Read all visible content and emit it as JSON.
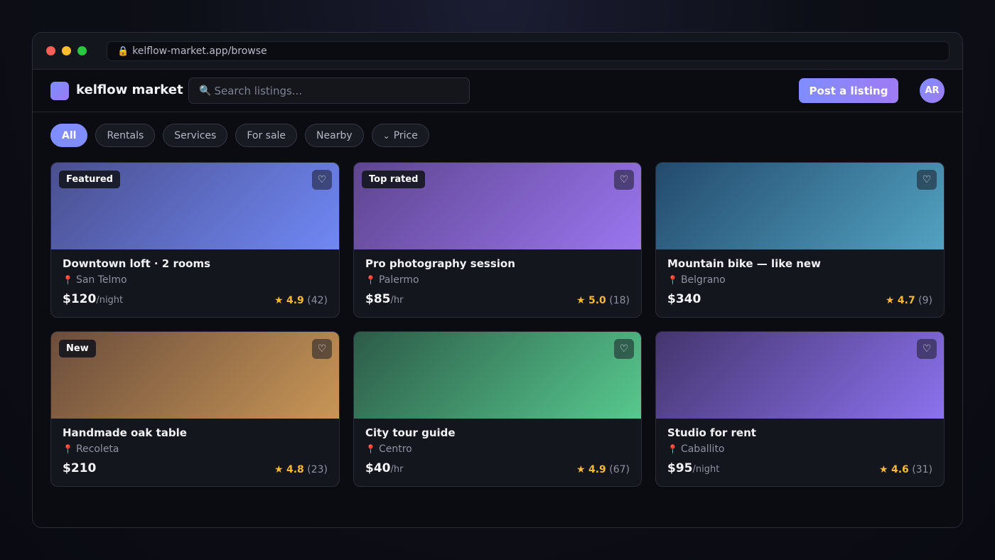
{
  "browser": {
    "url": "kelflow-market.app/browse",
    "lock_icon": "🔒"
  },
  "header": {
    "brand": "kelflow market",
    "search_placeholder": "Search listings...",
    "search_icon": "🔍",
    "post_button": "Post a listing",
    "avatar_initials": "AR"
  },
  "filters": [
    {
      "label": "All",
      "active": true
    },
    {
      "label": "Rentals",
      "active": false
    },
    {
      "label": "Services",
      "active": false
    },
    {
      "label": "For sale",
      "active": false
    },
    {
      "label": "Nearby",
      "active": false
    },
    {
      "label": "Price",
      "active": false,
      "icon": "⌄"
    }
  ],
  "listings": [
    {
      "title": "Downtown loft · 2 rooms",
      "location": "San Telmo",
      "price": "$120",
      "unit": "/night",
      "rating": "4.9",
      "reviews": "(42)",
      "badge": "Featured",
      "colors": [
        "#4a4f8e",
        "#7088f5"
      ]
    },
    {
      "title": "Pro photography session",
      "location": "Palermo",
      "price": "$85",
      "unit": "/hr",
      "rating": "5.0",
      "reviews": "(18)",
      "badge": "Top rated",
      "colors": [
        "#5e4590",
        "#9a76ef"
      ]
    },
    {
      "title": "Mountain bike — like new",
      "location": "Belgrano",
      "price": "$340",
      "unit": "",
      "rating": "4.7",
      "reviews": "(9)",
      "badge": "",
      "colors": [
        "#234a6d",
        "#52a2c1"
      ]
    },
    {
      "title": "Handmade oak table",
      "location": "Recoleta",
      "price": "$210",
      "unit": "",
      "rating": "4.8",
      "reviews": "(23)",
      "badge": "New",
      "colors": [
        "#6b4d3c",
        "#c89656"
      ]
    },
    {
      "title": "City tour guide",
      "location": "Centro",
      "price": "$40",
      "unit": "/hr",
      "rating": "4.9",
      "reviews": "(67)",
      "badge": "",
      "colors": [
        "#2c5b48",
        "#57c98e"
      ]
    },
    {
      "title": "Studio for rent",
      "location": "Caballito",
      "price": "$95",
      "unit": "/night",
      "rating": "4.6",
      "reviews": "(31)",
      "badge": "",
      "colors": [
        "#44356e",
        "#8c72ee"
      ]
    }
  ],
  "icons": {
    "heart": "♡",
    "pin": "📍",
    "star": "★"
  }
}
